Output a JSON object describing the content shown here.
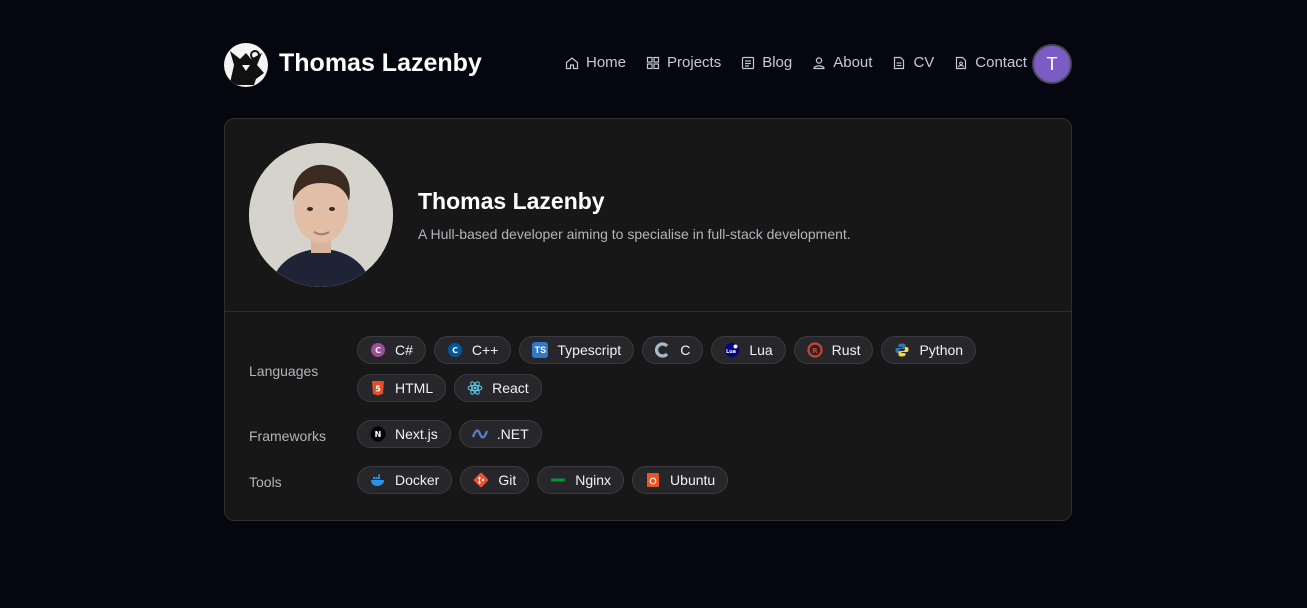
{
  "header": {
    "site_title": "Thomas Lazenby",
    "nav": [
      {
        "label": "Home",
        "icon": "home-icon"
      },
      {
        "label": "Projects",
        "icon": "grid-icon"
      },
      {
        "label": "Blog",
        "icon": "document-icon"
      },
      {
        "label": "About",
        "icon": "user-icon"
      },
      {
        "label": "CV",
        "icon": "file-icon"
      },
      {
        "label": "Contact",
        "icon": "contact-icon"
      }
    ],
    "avatar_initial": "T",
    "avatar_color": "#7c5cc4"
  },
  "profile": {
    "name": "Thomas Lazenby",
    "bio": "A Hull-based developer aiming to specialise in full-stack development."
  },
  "skills": {
    "languages_label": "Languages",
    "languages": [
      {
        "label": "C#",
        "icon": "csharp-icon",
        "color": "#9b4f96"
      },
      {
        "label": "C++",
        "icon": "cpp-icon",
        "color": "#00599c"
      },
      {
        "label": "Typescript",
        "icon": "typescript-icon",
        "color": "#3178c6"
      },
      {
        "label": "C",
        "icon": "c-icon",
        "color": "#a8b9cc"
      },
      {
        "label": "Lua",
        "icon": "lua-icon",
        "color": "#000080"
      },
      {
        "label": "Rust",
        "icon": "rust-icon",
        "color": "#ce422b"
      },
      {
        "label": "Python",
        "icon": "python-icon",
        "color": "#3776ab"
      },
      {
        "label": "HTML",
        "icon": "html5-icon",
        "color": "#e34f26"
      },
      {
        "label": "React",
        "icon": "react-icon",
        "color": "#61dafb"
      }
    ],
    "frameworks_label": "Frameworks",
    "frameworks": [
      {
        "label": "Next.js",
        "icon": "nextjs-icon",
        "color": "#000000"
      },
      {
        "label": ".NET",
        "icon": "dotnet-icon",
        "color": "#512bd4"
      }
    ],
    "tools_label": "Tools",
    "tools": [
      {
        "label": "Docker",
        "icon": "docker-icon",
        "color": "#2496ed"
      },
      {
        "label": "Git",
        "icon": "git-icon",
        "color": "#f05032"
      },
      {
        "label": "Nginx",
        "icon": "nginx-icon",
        "color": "#009639"
      },
      {
        "label": "Ubuntu",
        "icon": "ubuntu-icon",
        "color": "#e95420"
      }
    ]
  }
}
